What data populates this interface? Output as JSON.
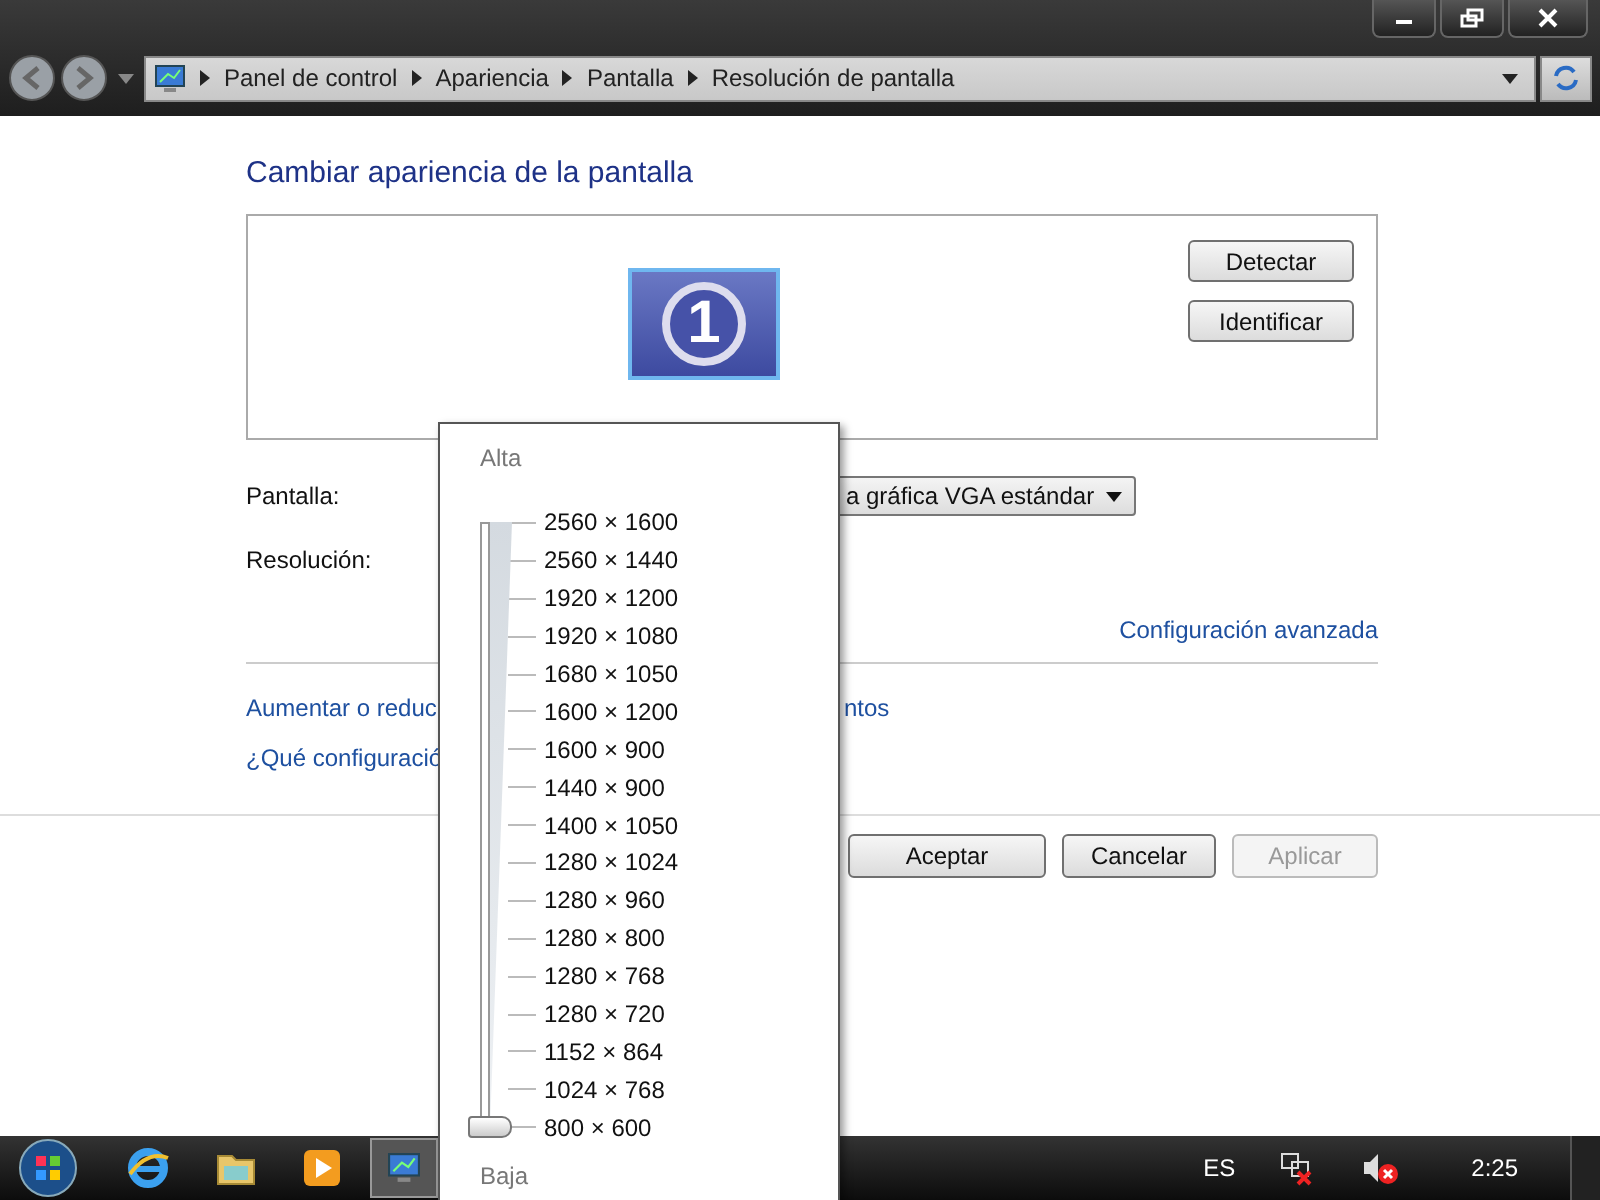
{
  "address_bar": {
    "breadcrumb": [
      "Panel de control",
      "Apariencia",
      "Pantalla",
      "Resolución de pantalla"
    ]
  },
  "heading": "Cambiar apariencia de la pantalla",
  "preview": {
    "monitor_number": "1",
    "buttons": [
      "Detectar",
      "Identificar"
    ]
  },
  "form": {
    "display_label": "Pantalla:",
    "display_value": "a gráfica VGA estándar",
    "resolution_label": "Resolución:"
  },
  "advanced_link": "Configuración avanzada",
  "links": [
    {
      "text": "Aumentar o reduc",
      "tail": "ntos"
    },
    {
      "text": "¿Qué configuració"
    }
  ],
  "dialog_buttons": [
    {
      "label": "Aceptar",
      "disabled": false
    },
    {
      "label": "Cancelar",
      "disabled": false
    },
    {
      "label": "Aplicar",
      "disabled": true
    }
  ],
  "resolution_popup": {
    "high_label": "Alta",
    "low_label": "Baja",
    "level": 0,
    "options": [
      "2560 × 1600",
      "2560 × 1440",
      "1920 × 1200",
      "1920 × 1080",
      "1680 × 1050",
      "1600 × 1200",
      "1600 × 900",
      "1440 × 900",
      "1400 × 1050",
      "1280 × 1024",
      "1280 × 960",
      "1280 × 800",
      "1280 × 768",
      "1280 × 720",
      "1152 × 864",
      "1024 × 768",
      "800 × 600"
    ]
  },
  "taskbar": {
    "language": "ES",
    "clock": "2:25"
  }
}
